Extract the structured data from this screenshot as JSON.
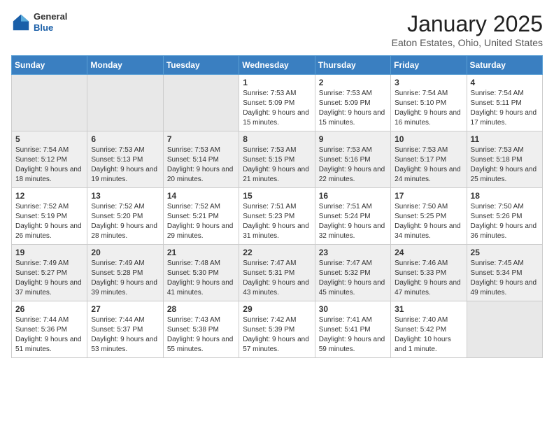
{
  "header": {
    "logo_line1": "General",
    "logo_line2": "Blue",
    "month_title": "January 2025",
    "location": "Eaton Estates, Ohio, United States"
  },
  "days_of_week": [
    "Sunday",
    "Monday",
    "Tuesday",
    "Wednesday",
    "Thursday",
    "Friday",
    "Saturday"
  ],
  "weeks": [
    [
      {
        "day": "",
        "sunrise": "",
        "sunset": "",
        "daylight": "",
        "empty": true
      },
      {
        "day": "",
        "sunrise": "",
        "sunset": "",
        "daylight": "",
        "empty": true
      },
      {
        "day": "",
        "sunrise": "",
        "sunset": "",
        "daylight": "",
        "empty": true
      },
      {
        "day": "1",
        "sunrise": "Sunrise: 7:53 AM",
        "sunset": "Sunset: 5:09 PM",
        "daylight": "Daylight: 9 hours and 15 minutes."
      },
      {
        "day": "2",
        "sunrise": "Sunrise: 7:53 AM",
        "sunset": "Sunset: 5:09 PM",
        "daylight": "Daylight: 9 hours and 15 minutes."
      },
      {
        "day": "3",
        "sunrise": "Sunrise: 7:54 AM",
        "sunset": "Sunset: 5:10 PM",
        "daylight": "Daylight: 9 hours and 16 minutes."
      },
      {
        "day": "4",
        "sunrise": "Sunrise: 7:54 AM",
        "sunset": "Sunset: 5:11 PM",
        "daylight": "Daylight: 9 hours and 17 minutes."
      }
    ],
    [
      {
        "day": "5",
        "sunrise": "Sunrise: 7:54 AM",
        "sunset": "Sunset: 5:12 PM",
        "daylight": "Daylight: 9 hours and 18 minutes."
      },
      {
        "day": "6",
        "sunrise": "Sunrise: 7:53 AM",
        "sunset": "Sunset: 5:13 PM",
        "daylight": "Daylight: 9 hours and 19 minutes."
      },
      {
        "day": "7",
        "sunrise": "Sunrise: 7:53 AM",
        "sunset": "Sunset: 5:14 PM",
        "daylight": "Daylight: 9 hours and 20 minutes."
      },
      {
        "day": "8",
        "sunrise": "Sunrise: 7:53 AM",
        "sunset": "Sunset: 5:15 PM",
        "daylight": "Daylight: 9 hours and 21 minutes."
      },
      {
        "day": "9",
        "sunrise": "Sunrise: 7:53 AM",
        "sunset": "Sunset: 5:16 PM",
        "daylight": "Daylight: 9 hours and 22 minutes."
      },
      {
        "day": "10",
        "sunrise": "Sunrise: 7:53 AM",
        "sunset": "Sunset: 5:17 PM",
        "daylight": "Daylight: 9 hours and 24 minutes."
      },
      {
        "day": "11",
        "sunrise": "Sunrise: 7:53 AM",
        "sunset": "Sunset: 5:18 PM",
        "daylight": "Daylight: 9 hours and 25 minutes."
      }
    ],
    [
      {
        "day": "12",
        "sunrise": "Sunrise: 7:52 AM",
        "sunset": "Sunset: 5:19 PM",
        "daylight": "Daylight: 9 hours and 26 minutes."
      },
      {
        "day": "13",
        "sunrise": "Sunrise: 7:52 AM",
        "sunset": "Sunset: 5:20 PM",
        "daylight": "Daylight: 9 hours and 28 minutes."
      },
      {
        "day": "14",
        "sunrise": "Sunrise: 7:52 AM",
        "sunset": "Sunset: 5:21 PM",
        "daylight": "Daylight: 9 hours and 29 minutes."
      },
      {
        "day": "15",
        "sunrise": "Sunrise: 7:51 AM",
        "sunset": "Sunset: 5:23 PM",
        "daylight": "Daylight: 9 hours and 31 minutes."
      },
      {
        "day": "16",
        "sunrise": "Sunrise: 7:51 AM",
        "sunset": "Sunset: 5:24 PM",
        "daylight": "Daylight: 9 hours and 32 minutes."
      },
      {
        "day": "17",
        "sunrise": "Sunrise: 7:50 AM",
        "sunset": "Sunset: 5:25 PM",
        "daylight": "Daylight: 9 hours and 34 minutes."
      },
      {
        "day": "18",
        "sunrise": "Sunrise: 7:50 AM",
        "sunset": "Sunset: 5:26 PM",
        "daylight": "Daylight: 9 hours and 36 minutes."
      }
    ],
    [
      {
        "day": "19",
        "sunrise": "Sunrise: 7:49 AM",
        "sunset": "Sunset: 5:27 PM",
        "daylight": "Daylight: 9 hours and 37 minutes."
      },
      {
        "day": "20",
        "sunrise": "Sunrise: 7:49 AM",
        "sunset": "Sunset: 5:28 PM",
        "daylight": "Daylight: 9 hours and 39 minutes."
      },
      {
        "day": "21",
        "sunrise": "Sunrise: 7:48 AM",
        "sunset": "Sunset: 5:30 PM",
        "daylight": "Daylight: 9 hours and 41 minutes."
      },
      {
        "day": "22",
        "sunrise": "Sunrise: 7:47 AM",
        "sunset": "Sunset: 5:31 PM",
        "daylight": "Daylight: 9 hours and 43 minutes."
      },
      {
        "day": "23",
        "sunrise": "Sunrise: 7:47 AM",
        "sunset": "Sunset: 5:32 PM",
        "daylight": "Daylight: 9 hours and 45 minutes."
      },
      {
        "day": "24",
        "sunrise": "Sunrise: 7:46 AM",
        "sunset": "Sunset: 5:33 PM",
        "daylight": "Daylight: 9 hours and 47 minutes."
      },
      {
        "day": "25",
        "sunrise": "Sunrise: 7:45 AM",
        "sunset": "Sunset: 5:34 PM",
        "daylight": "Daylight: 9 hours and 49 minutes."
      }
    ],
    [
      {
        "day": "26",
        "sunrise": "Sunrise: 7:44 AM",
        "sunset": "Sunset: 5:36 PM",
        "daylight": "Daylight: 9 hours and 51 minutes."
      },
      {
        "day": "27",
        "sunrise": "Sunrise: 7:44 AM",
        "sunset": "Sunset: 5:37 PM",
        "daylight": "Daylight: 9 hours and 53 minutes."
      },
      {
        "day": "28",
        "sunrise": "Sunrise: 7:43 AM",
        "sunset": "Sunset: 5:38 PM",
        "daylight": "Daylight: 9 hours and 55 minutes."
      },
      {
        "day": "29",
        "sunrise": "Sunrise: 7:42 AM",
        "sunset": "Sunset: 5:39 PM",
        "daylight": "Daylight: 9 hours and 57 minutes."
      },
      {
        "day": "30",
        "sunrise": "Sunrise: 7:41 AM",
        "sunset": "Sunset: 5:41 PM",
        "daylight": "Daylight: 9 hours and 59 minutes."
      },
      {
        "day": "31",
        "sunrise": "Sunrise: 7:40 AM",
        "sunset": "Sunset: 5:42 PM",
        "daylight": "Daylight: 10 hours and 1 minute."
      },
      {
        "day": "",
        "sunrise": "",
        "sunset": "",
        "daylight": "",
        "empty": true
      }
    ]
  ]
}
